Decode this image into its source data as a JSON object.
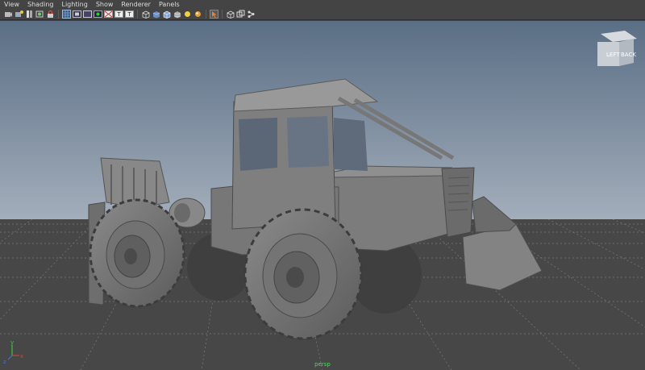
{
  "menu": [
    {
      "label": "View"
    },
    {
      "label": "Shading"
    },
    {
      "label": "Lighting"
    },
    {
      "label": "Show"
    },
    {
      "label": "Renderer"
    },
    {
      "label": "Panels"
    }
  ],
  "toolbar": {
    "groups": [
      [
        "camera-select-icon",
        "camera-attributes-icon",
        "bookmark-icon",
        "image-plane-icon",
        "lock-camera-icon"
      ],
      [
        "grid-icon",
        "film-gate-icon",
        "resolution-gate-icon",
        "gate-mask-icon",
        "field-chart-icon",
        "safe-action-icon",
        "safe-title-icon"
      ],
      [
        "wireframe-icon",
        "smooth-shade-icon",
        "wireframe-on-shaded-icon",
        "textured-icon",
        "use-all-lights-icon",
        "shadows-icon"
      ],
      [
        "select-camera-icon"
      ],
      [
        "isolate-select-icon",
        "xray-icon",
        "xray-joints-icon"
      ]
    ]
  },
  "viewcube": {
    "front_face": "LEFT",
    "side_face": "BACK"
  },
  "viewport": {
    "camera_label": "persp",
    "axis": {
      "x": "x",
      "y": "y",
      "z": "z"
    },
    "colors": {
      "sky_top": "#5a6e85",
      "sky_bottom": "#a3aebb",
      "ground": "#474747",
      "grid": "#8a8a8a",
      "model": "#7c7c7c",
      "axis_x": "#d04040",
      "axis_y": "#40c040",
      "axis_z": "#4070e0"
    }
  }
}
